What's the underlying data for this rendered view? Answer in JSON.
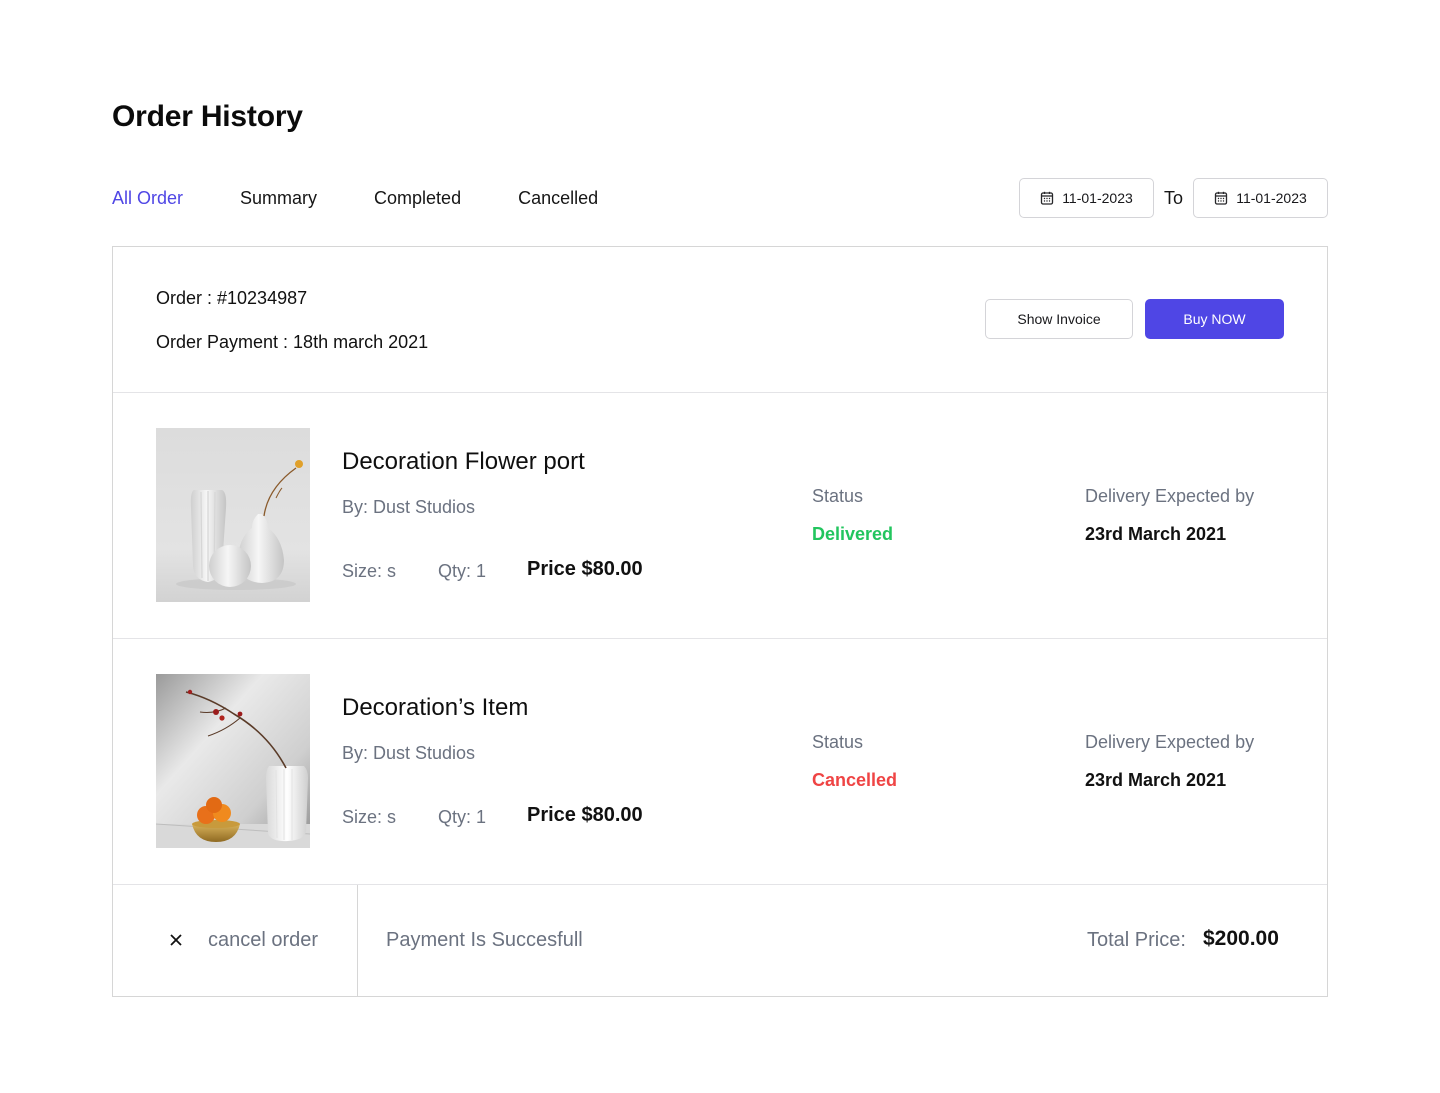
{
  "page": {
    "title": "Order History"
  },
  "tabs": [
    {
      "label": "All Order",
      "active": true
    },
    {
      "label": "Summary",
      "active": false
    },
    {
      "label": "Completed",
      "active": false
    },
    {
      "label": "Cancelled",
      "active": false
    }
  ],
  "date_range": {
    "from": "11-01-2023",
    "separator": "To",
    "to": "11-01-2023",
    "icon": "calendar-icon"
  },
  "order": {
    "id_text": "Order : #10234987",
    "payment_text": "Order Payment : 18th march 2021",
    "show_invoice_label": "Show Invoice",
    "buy_now_label": "Buy NOW",
    "items": [
      {
        "name": "Decoration Flower port",
        "by": "By: Dust Studios",
        "size": "Size: s",
        "qty": "Qty: 1",
        "price": "Price $80.00",
        "status_label": "Status",
        "status": "Delivered",
        "status_color": "#22c55e",
        "delivery_label": "Delivery Expected by",
        "delivery_date": "23rd March 2021"
      },
      {
        "name": "Decoration’s Item",
        "by": "By: Dust Studios",
        "size": "Size: s",
        "qty": "Qty: 1",
        "price": "Price $80.00",
        "status_label": "Status",
        "status": "Cancelled",
        "status_color": "#ef4444",
        "delivery_label": "Delivery Expected by",
        "delivery_date": "23rd March 2021"
      }
    ],
    "footer": {
      "cancel_label": "cancel order",
      "payment_message": "Payment Is Succesfull",
      "total_label": "Total Price:",
      "total_value": "$200.00"
    }
  },
  "colors": {
    "accent": "#4f46e5",
    "delivered": "#22c55e",
    "cancelled": "#ef4444",
    "muted": "#6b7280"
  }
}
